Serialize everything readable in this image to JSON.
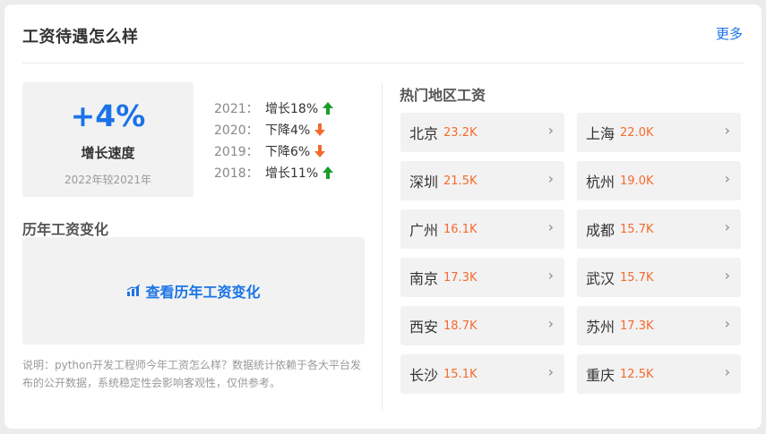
{
  "header": {
    "title": "工资待遇怎么样",
    "more_label": "更多"
  },
  "growth": {
    "value": "+4%",
    "label": "增长速度",
    "sub": "2022年较2021年"
  },
  "history": [
    {
      "year": "2021：",
      "change": "增长18%",
      "direction": "up"
    },
    {
      "year": "2020：",
      "change": "下降4%",
      "direction": "down"
    },
    {
      "year": "2019：",
      "change": "下降6%",
      "direction": "down"
    },
    {
      "year": "2018：",
      "change": "增长11%",
      "direction": "up"
    }
  ],
  "history_section": {
    "heading": "历年工资变化",
    "link_label": "查看历年工资变化",
    "link_icon": "bar-chart-icon"
  },
  "note": "说明：python开发工程师今年工资怎么样？数据统计依赖于各大平台发布的公开数据，系统稳定性会影响客观性，仅供参考。",
  "regions": {
    "heading": "热门地区工资",
    "items": [
      {
        "city": "北京",
        "salary": "23.2K"
      },
      {
        "city": "上海",
        "salary": "22.0K"
      },
      {
        "city": "深圳",
        "salary": "21.5K"
      },
      {
        "city": "杭州",
        "salary": "19.0K"
      },
      {
        "city": "广州",
        "salary": "16.1K"
      },
      {
        "city": "成都",
        "salary": "15.7K"
      },
      {
        "city": "南京",
        "salary": "17.3K"
      },
      {
        "city": "武汉",
        "salary": "15.7K"
      },
      {
        "city": "西安",
        "salary": "18.7K"
      },
      {
        "city": "苏州",
        "salary": "17.3K"
      },
      {
        "city": "长沙",
        "salary": "15.1K"
      },
      {
        "city": "重庆",
        "salary": "12.5K"
      }
    ]
  },
  "colors": {
    "accent": "#1a73e8",
    "salary": "#f56a2e",
    "up": "#1a9c2a",
    "down": "#f56a2e"
  }
}
